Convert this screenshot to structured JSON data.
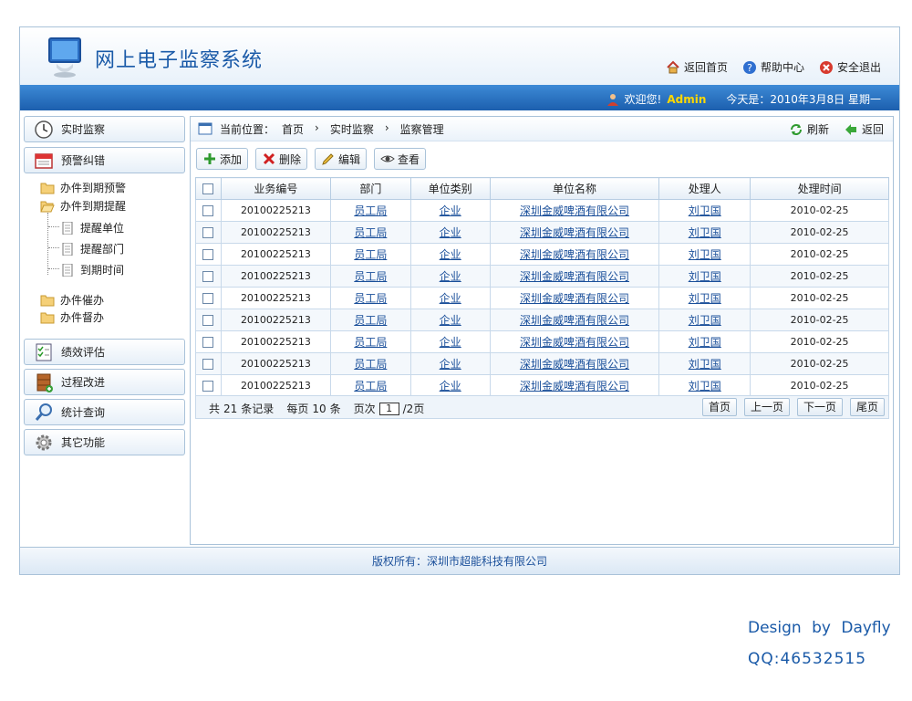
{
  "header": {
    "title": "网上电子监察系统",
    "links": {
      "home": "返回首页",
      "help": "帮助中心",
      "logout": "安全退出"
    }
  },
  "bluebar": {
    "welcome": "欢迎您!",
    "user": "Admin",
    "today": "今天是：2010年3月8日 星期一"
  },
  "sidebar": {
    "realtime": "实时监察",
    "warning": "预警纠错",
    "tree": {
      "expire_warning": "办件到期预警",
      "expire_remind": "办件到期提醒",
      "remind_unit": "提醒单位",
      "remind_dept": "提醒部门",
      "expire_time": "到期时间",
      "urge": "办件催办",
      "supervise": "办件督办"
    },
    "performance": "绩效评估",
    "process": "过程改进",
    "stats": "统计查询",
    "other": "其它功能"
  },
  "main": {
    "crumb_label": "当前位置：",
    "crumbs": [
      "首页",
      "›",
      "实时监察",
      "›",
      "监察管理"
    ],
    "refresh": "刷新",
    "back": "返回",
    "toolbar": {
      "add": "添加",
      "delete": "删除",
      "edit": "编辑",
      "view": "查看"
    },
    "columns": [
      "业务编号",
      "部门",
      "单位类别",
      "单位名称",
      "处理人",
      "处理时间"
    ],
    "rows": [
      [
        "20100225213",
        "员工局",
        "企业",
        "深圳金威啤酒有限公司",
        "刘卫国",
        "2010-02-25"
      ],
      [
        "20100225213",
        "员工局",
        "企业",
        "深圳金威啤酒有限公司",
        "刘卫国",
        "2010-02-25"
      ],
      [
        "20100225213",
        "员工局",
        "企业",
        "深圳金威啤酒有限公司",
        "刘卫国",
        "2010-02-25"
      ],
      [
        "20100225213",
        "员工局",
        "企业",
        "深圳金威啤酒有限公司",
        "刘卫国",
        "2010-02-25"
      ],
      [
        "20100225213",
        "员工局",
        "企业",
        "深圳金威啤酒有限公司",
        "刘卫国",
        "2010-02-25"
      ],
      [
        "20100225213",
        "员工局",
        "企业",
        "深圳金威啤酒有限公司",
        "刘卫国",
        "2010-02-25"
      ],
      [
        "20100225213",
        "员工局",
        "企业",
        "深圳金威啤酒有限公司",
        "刘卫国",
        "2010-02-25"
      ],
      [
        "20100225213",
        "员工局",
        "企业",
        "深圳金威啤酒有限公司",
        "刘卫国",
        "2010-02-25"
      ],
      [
        "20100225213",
        "员工局",
        "企业",
        "深圳金威啤酒有限公司",
        "刘卫国",
        "2010-02-25"
      ]
    ],
    "pager": {
      "total_prefix": "共",
      "total": "21",
      "total_suffix": "条记录",
      "per_prefix": "每页",
      "per": "10",
      "per_suffix": "条",
      "page_prefix": "页次",
      "page": "1",
      "page_suffix": "/2页",
      "first": "首页",
      "prev": "上一页",
      "next": "下一页",
      "last": "尾页"
    }
  },
  "footer": {
    "copyright": "版权所有：深圳市超能科技有限公司"
  },
  "credit": {
    "design": "Design by Dayfly",
    "qq": "QQ:46532515"
  }
}
